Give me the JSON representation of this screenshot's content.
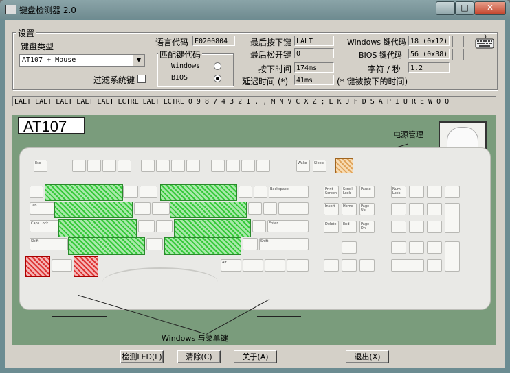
{
  "window": {
    "title": "键盘检测器 2.0",
    "minimize": "–",
    "maximize": "□",
    "close": "✕"
  },
  "settings": {
    "group_label": "设置",
    "keyboard_type_label": "键盘类型",
    "keyboard_type_value": "AT107 + Mouse",
    "filter_label": "过滤系统键",
    "lang_code_label": "语言代码",
    "lang_code_value": "E0200804",
    "match_group_label": "匹配键代码",
    "match_windows": "Windows",
    "match_bios": "BIOS",
    "selected_match": "BIOS"
  },
  "status": {
    "last_down_label": "最后按下键",
    "last_down_value": "LALT",
    "last_up_label": "最后松开键",
    "last_up_value": "0",
    "press_time_label": "按下时间",
    "press_time_value": "174ms",
    "delay_label": "延迟时间 (*)",
    "delay_value": "41ms",
    "delay_note": "(* 键被按下的时间)",
    "win_code_label": "Windows 键代码",
    "win_code_value": "18 (0x12)",
    "bios_code_label": "BIOS 键代码",
    "bios_code_value": "56 (0x38)",
    "cps_label": "字符 / 秒",
    "cps_value": "1.2"
  },
  "history": "LALT LALT LALT LALT LALT LCTRL LALT LCTRL 0 9 8 7 4 3 2 1 . , M N V C X Z ; L K J F D S A P I U R E W O Q",
  "keyboard": {
    "model": "AT107",
    "power_label": "电源管理",
    "winmenu_label": "Windows 与菜单键",
    "keys": {
      "esc": "Esc",
      "prtsc": "Print\nScreen",
      "scroll": "Scroll\nLock",
      "pause": "Pause",
      "backspace": "Backspace",
      "tab": "Tab",
      "caps": "Caps Lock",
      "enter": "Enter",
      "shift": "Shift",
      "alt": "Alt",
      "insert": "Insert",
      "home": "Home",
      "pgup": "Page\nUp",
      "delete": "Delete",
      "end": "End",
      "pgdn": "Page\nDn",
      "numlock": "Num\nLock",
      "sleep": "Sleep",
      "wake": "Wake",
      "power": "Power"
    }
  },
  "buttons": {
    "led": "检测LED(L)",
    "clear": "清除(C)",
    "about": "关于(A)",
    "exit": "退出(X)"
  }
}
